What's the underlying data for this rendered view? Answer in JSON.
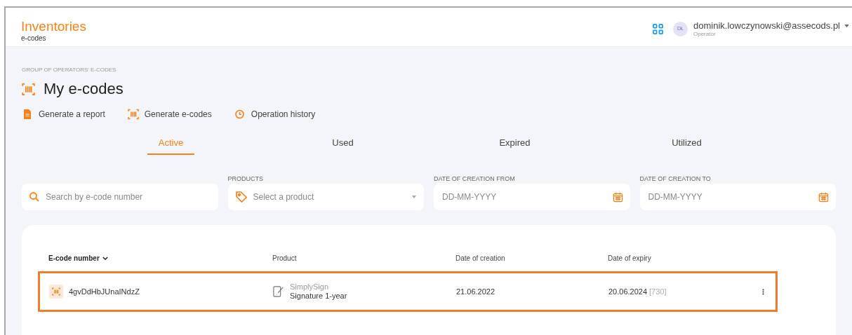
{
  "header": {
    "title": "Inventories",
    "subtitle": "e-codes",
    "user": {
      "initials": "DŁ",
      "email": "dominik.lowczynowski@assecods.pl",
      "role": "Operator"
    }
  },
  "page": {
    "overline": "GROUP OF OPERATORS' E-CODES",
    "title": "My e-codes"
  },
  "actions": [
    {
      "kind": "report",
      "label": "Generate a report"
    },
    {
      "kind": "generate",
      "label": "Generate e-codes"
    },
    {
      "kind": "history",
      "label": "Operation history"
    }
  ],
  "tabs": [
    {
      "label": "Active",
      "selected": true
    },
    {
      "label": "Used",
      "selected": false
    },
    {
      "label": "Expired",
      "selected": false
    },
    {
      "label": "Utilized",
      "selected": false
    }
  ],
  "filters": [
    {
      "kind": "search",
      "placeholder": "Search by e-code number"
    },
    {
      "kind": "select",
      "label": "PRODUCTS",
      "placeholder": "Select a product"
    },
    {
      "kind": "date",
      "label": "DATE OF CREATION FROM",
      "placeholder": "DD-MM-YYYY"
    },
    {
      "kind": "date",
      "label": "DATE OF CREATION TO",
      "placeholder": "DD-MM-YYYY"
    }
  ],
  "table": {
    "columns": [
      {
        "label": "E-code number",
        "sorted": true
      },
      {
        "label": "Product",
        "sorted": false
      },
      {
        "label": "Date of creation",
        "sorted": false
      },
      {
        "label": "Date of expiry",
        "sorted": false
      }
    ],
    "rows": [
      {
        "code": "4gvDdHbJUnaINdzZ",
        "product_brand": "SimplySign",
        "product_name": "Signature 1-year",
        "created": "21.06.2022",
        "expiry": "20.06.2024",
        "days": "[730]",
        "highlighted": true
      }
    ]
  }
}
